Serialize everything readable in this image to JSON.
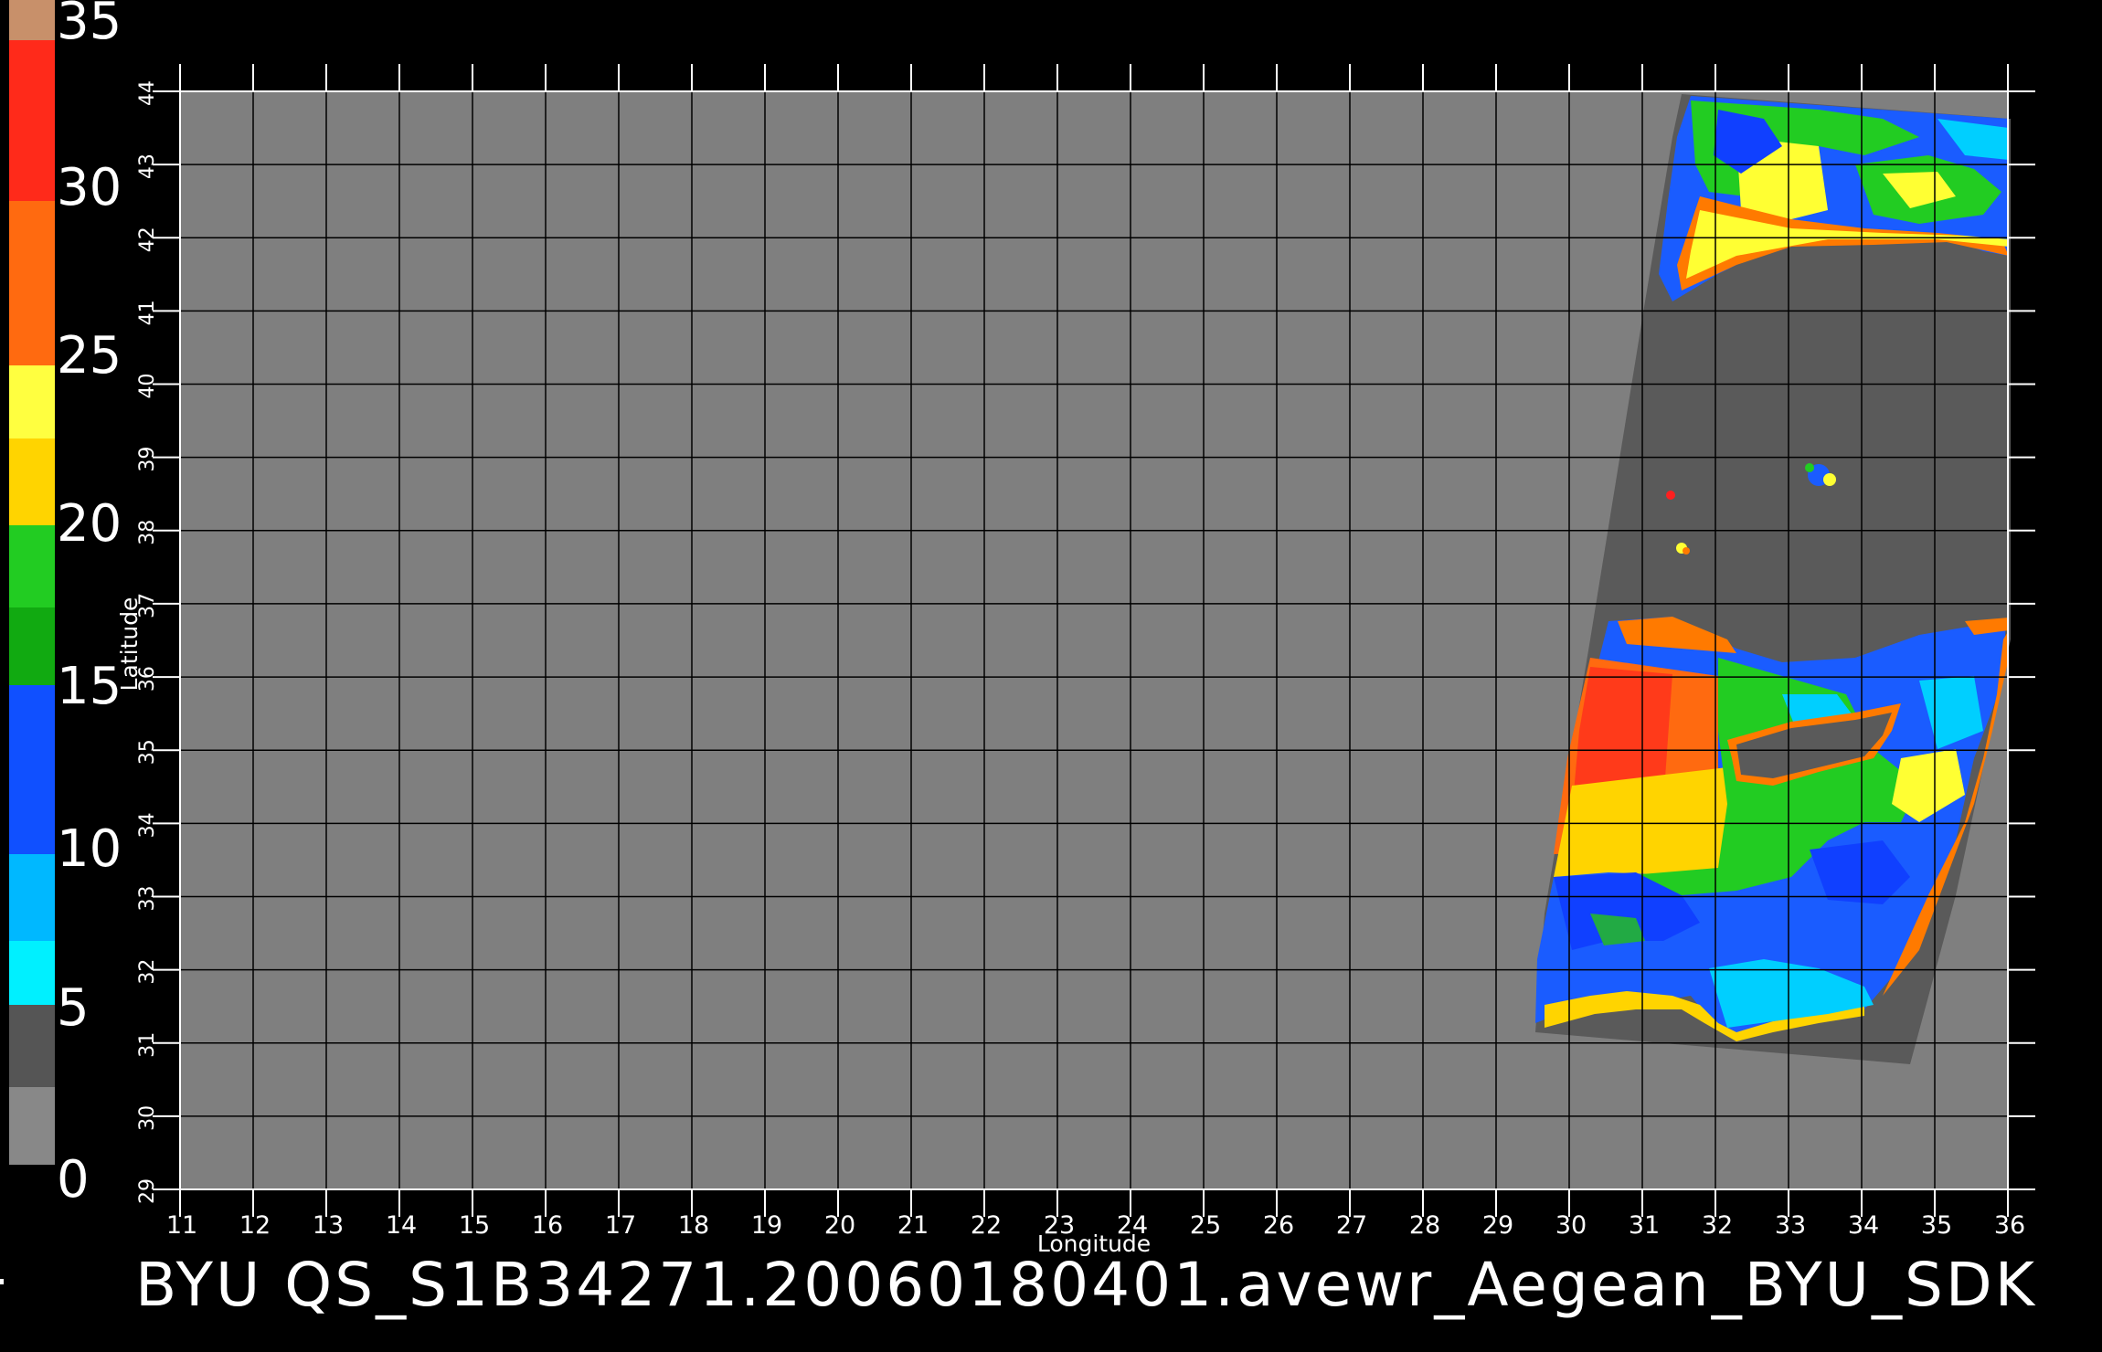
{
  "title": "BYU  QS_S1B34271.20060180401.avewr_Aegean_BYU_SDK",
  "axes": {
    "xlabel": "Longitude",
    "ylabel": "Latitude",
    "x_ticks": [
      "11",
      "12",
      "13",
      "14",
      "15",
      "16",
      "17",
      "18",
      "19",
      "20",
      "21",
      "22",
      "23",
      "24",
      "25",
      "26",
      "27",
      "28",
      "29",
      "30",
      "31",
      "32",
      "33",
      "34",
      "35",
      "36"
    ],
    "y_ticks": [
      "29",
      "30",
      "31",
      "32",
      "33",
      "34",
      "35",
      "36",
      "37",
      "38",
      "39",
      "40",
      "41",
      "42",
      "43",
      "44"
    ]
  },
  "colorbar": {
    "labels": [
      "0",
      "5",
      "10",
      "15",
      "20",
      "25",
      "30",
      "35"
    ],
    "colors": [
      "#777777",
      "#444444",
      "#00e5ff",
      "#1060ff",
      "#008a00",
      "#22dd22",
      "#ffff33",
      "#ffc000",
      "#ff7a00",
      "#cc2200",
      "#ff2020",
      "#d08860"
    ]
  },
  "map_colors": {
    "background": "#7f7f7f",
    "swath": "#5a5a5a",
    "grid": "#000000"
  }
}
